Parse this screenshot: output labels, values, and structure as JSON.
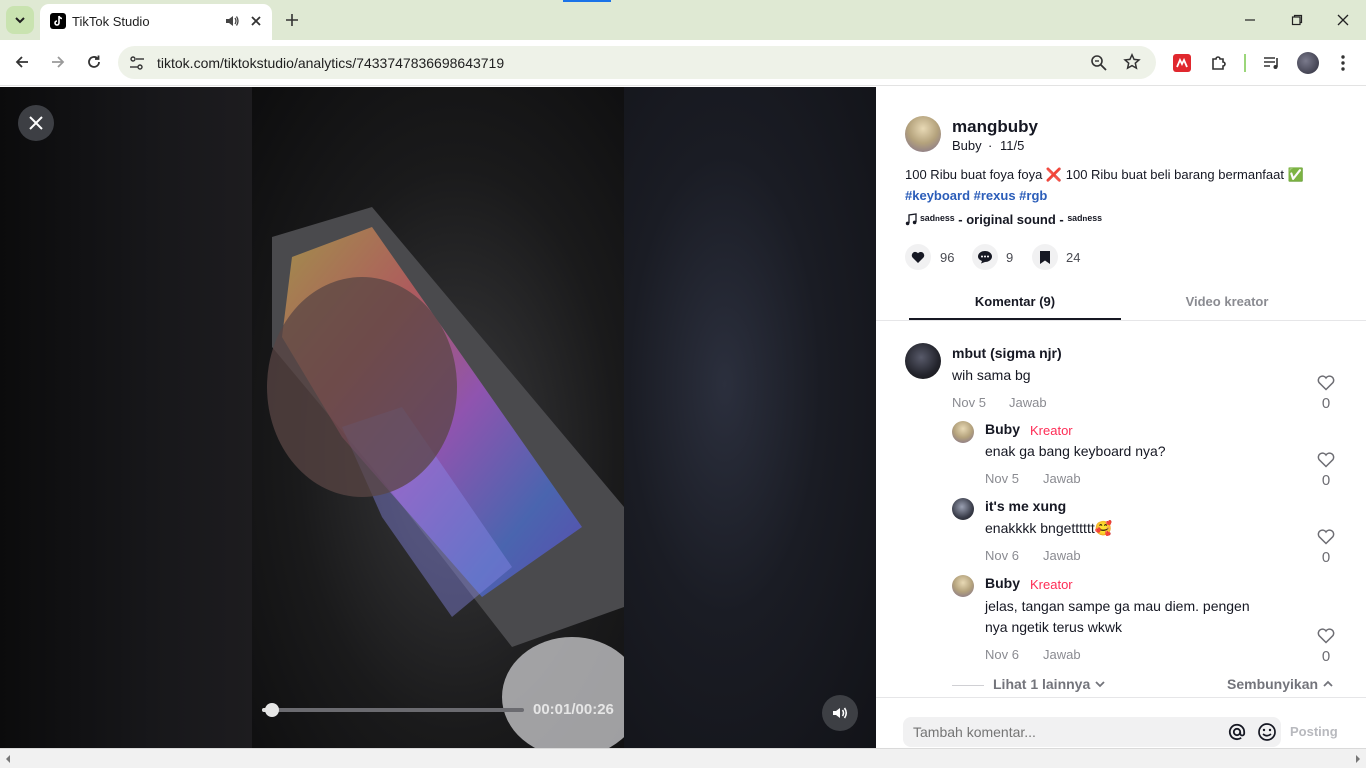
{
  "browser": {
    "tab_title": "TikTok Studio",
    "url": "tiktok.com/tiktokstudio/analytics/7433747836698643719"
  },
  "video": {
    "time_display": "00:01/00:26",
    "progress": 0.04
  },
  "post": {
    "username": "mangbuby",
    "display_name": "Buby",
    "date": "11/5",
    "caption": "100 Ribu buat foya foya ❌ 100 Ribu buat beli barang bermanfaat ✅",
    "hashtags": "#keyboard #rexus #rgb",
    "sound": "ˢᵃᵈⁿᵉˢˢ - original sound - ˢᵃᵈⁿᵉˢˢ",
    "likes": "96",
    "comments": "9",
    "saves": "24"
  },
  "tabs": {
    "comments": "Komentar (9)",
    "creator_videos": "Video kreator"
  },
  "comments": [
    {
      "name": "mbut (sigma njr)",
      "text": "wih sama bg",
      "date": "Nov 5",
      "reply": "Jawab",
      "likes": "0"
    },
    {
      "name": "Buby",
      "badge": "Kreator",
      "text": "enak ga bang keyboard nya?",
      "date": "Nov 5",
      "reply": "Jawab",
      "likes": "0"
    },
    {
      "name": "it's me xung",
      "text": "enakkkk bngetttttt🥰",
      "date": "Nov 6",
      "reply": "Jawab",
      "likes": "0"
    },
    {
      "name": "Buby",
      "badge": "Kreator",
      "text_line1": "jelas, tangan sampe ga mau diem. pengen",
      "text_line2": "nya ngetik terus wkwk",
      "date": "Nov 6",
      "reply": "Jawab",
      "likes": "0"
    }
  ],
  "thread": {
    "see_more": "Lihat 1 lainnya",
    "hide": "Sembunyikan"
  },
  "composer": {
    "placeholder": "Tambah komentar...",
    "post_label": "Posting"
  },
  "colors": {
    "creator_badge": "#fe2c55",
    "hashtag": "#2b5db9",
    "tabbar": "#dfe9d3"
  }
}
